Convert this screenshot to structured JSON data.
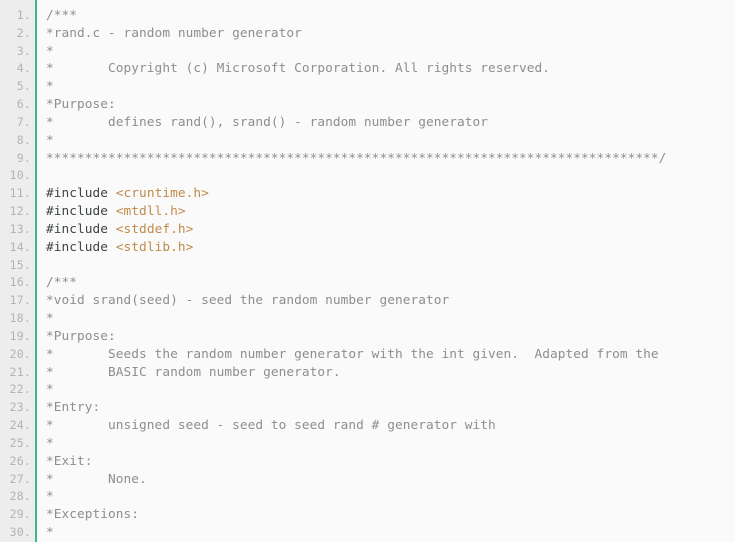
{
  "viewer": {
    "kind": "source-code-listing",
    "language": "c",
    "file_name": "rand.c",
    "total_visible_lines": 30,
    "first_visible_line": 1,
    "last_visible_line": 30,
    "colors": {
      "background": "#fafafa",
      "gutter_background": "#ededed",
      "gutter_accent": "#3cb795",
      "line_number": "#b3b3b3",
      "comment": "#8e8e8e",
      "preprocessor": "#3f4544",
      "header_name": "#c08a4a"
    }
  },
  "gutter": {
    "numbers": [
      "1.",
      "2.",
      "3.",
      "4.",
      "5.",
      "6.",
      "7.",
      "8.",
      "9.",
      "10.",
      "11.",
      "12.",
      "13.",
      "14.",
      "15.",
      "16.",
      "17.",
      "18.",
      "19.",
      "20.",
      "21.",
      "22.",
      "23.",
      "24.",
      "25.",
      "26.",
      "27.",
      "28.",
      "29.",
      "30."
    ]
  },
  "code": {
    "lines": [
      {
        "n": 1,
        "tokens": [
          {
            "t": "comment",
            "s": "/***"
          }
        ]
      },
      {
        "n": 2,
        "tokens": [
          {
            "t": "comment",
            "s": "*rand.c - random number generator"
          }
        ]
      },
      {
        "n": 3,
        "tokens": [
          {
            "t": "comment",
            "s": "*"
          }
        ]
      },
      {
        "n": 4,
        "tokens": [
          {
            "t": "comment",
            "s": "*       Copyright (c) Microsoft Corporation. All rights reserved."
          }
        ]
      },
      {
        "n": 5,
        "tokens": [
          {
            "t": "comment",
            "s": "*"
          }
        ]
      },
      {
        "n": 6,
        "tokens": [
          {
            "t": "comment",
            "s": "*Purpose:"
          }
        ]
      },
      {
        "n": 7,
        "tokens": [
          {
            "t": "comment",
            "s": "*       defines rand(), srand() - random number generator"
          }
        ]
      },
      {
        "n": 8,
        "tokens": [
          {
            "t": "comment",
            "s": "*"
          }
        ]
      },
      {
        "n": 9,
        "tokens": [
          {
            "t": "comment",
            "s": "*******************************************************************************/"
          }
        ]
      },
      {
        "n": 10,
        "tokens": [
          {
            "t": "blank",
            "s": ""
          }
        ]
      },
      {
        "n": 11,
        "tokens": [
          {
            "t": "pp",
            "s": "#include "
          },
          {
            "t": "header",
            "s": "<cruntime.h>"
          }
        ]
      },
      {
        "n": 12,
        "tokens": [
          {
            "t": "pp",
            "s": "#include "
          },
          {
            "t": "header",
            "s": "<mtdll.h>"
          }
        ]
      },
      {
        "n": 13,
        "tokens": [
          {
            "t": "pp",
            "s": "#include "
          },
          {
            "t": "header",
            "s": "<stddef.h>"
          }
        ]
      },
      {
        "n": 14,
        "tokens": [
          {
            "t": "pp",
            "s": "#include "
          },
          {
            "t": "header",
            "s": "<stdlib.h>"
          }
        ]
      },
      {
        "n": 15,
        "tokens": [
          {
            "t": "blank",
            "s": ""
          }
        ]
      },
      {
        "n": 16,
        "tokens": [
          {
            "t": "comment",
            "s": "/***"
          }
        ]
      },
      {
        "n": 17,
        "tokens": [
          {
            "t": "comment",
            "s": "*void srand(seed) - seed the random number generator"
          }
        ]
      },
      {
        "n": 18,
        "tokens": [
          {
            "t": "comment",
            "s": "*"
          }
        ]
      },
      {
        "n": 19,
        "tokens": [
          {
            "t": "comment",
            "s": "*Purpose:"
          }
        ]
      },
      {
        "n": 20,
        "tokens": [
          {
            "t": "comment",
            "s": "*       Seeds the random number generator with the int given.  Adapted from the"
          }
        ]
      },
      {
        "n": 21,
        "tokens": [
          {
            "t": "comment",
            "s": "*       BASIC random number generator."
          }
        ]
      },
      {
        "n": 22,
        "tokens": [
          {
            "t": "comment",
            "s": "*"
          }
        ]
      },
      {
        "n": 23,
        "tokens": [
          {
            "t": "comment",
            "s": "*Entry:"
          }
        ]
      },
      {
        "n": 24,
        "tokens": [
          {
            "t": "comment",
            "s": "*       unsigned seed - seed to seed rand # generator with"
          }
        ]
      },
      {
        "n": 25,
        "tokens": [
          {
            "t": "comment",
            "s": "*"
          }
        ]
      },
      {
        "n": 26,
        "tokens": [
          {
            "t": "comment",
            "s": "*Exit:"
          }
        ]
      },
      {
        "n": 27,
        "tokens": [
          {
            "t": "comment",
            "s": "*       None."
          }
        ]
      },
      {
        "n": 28,
        "tokens": [
          {
            "t": "comment",
            "s": "*"
          }
        ]
      },
      {
        "n": 29,
        "tokens": [
          {
            "t": "comment",
            "s": "*Exceptions:"
          }
        ]
      },
      {
        "n": 30,
        "tokens": [
          {
            "t": "comment",
            "s": "*"
          }
        ]
      }
    ]
  }
}
